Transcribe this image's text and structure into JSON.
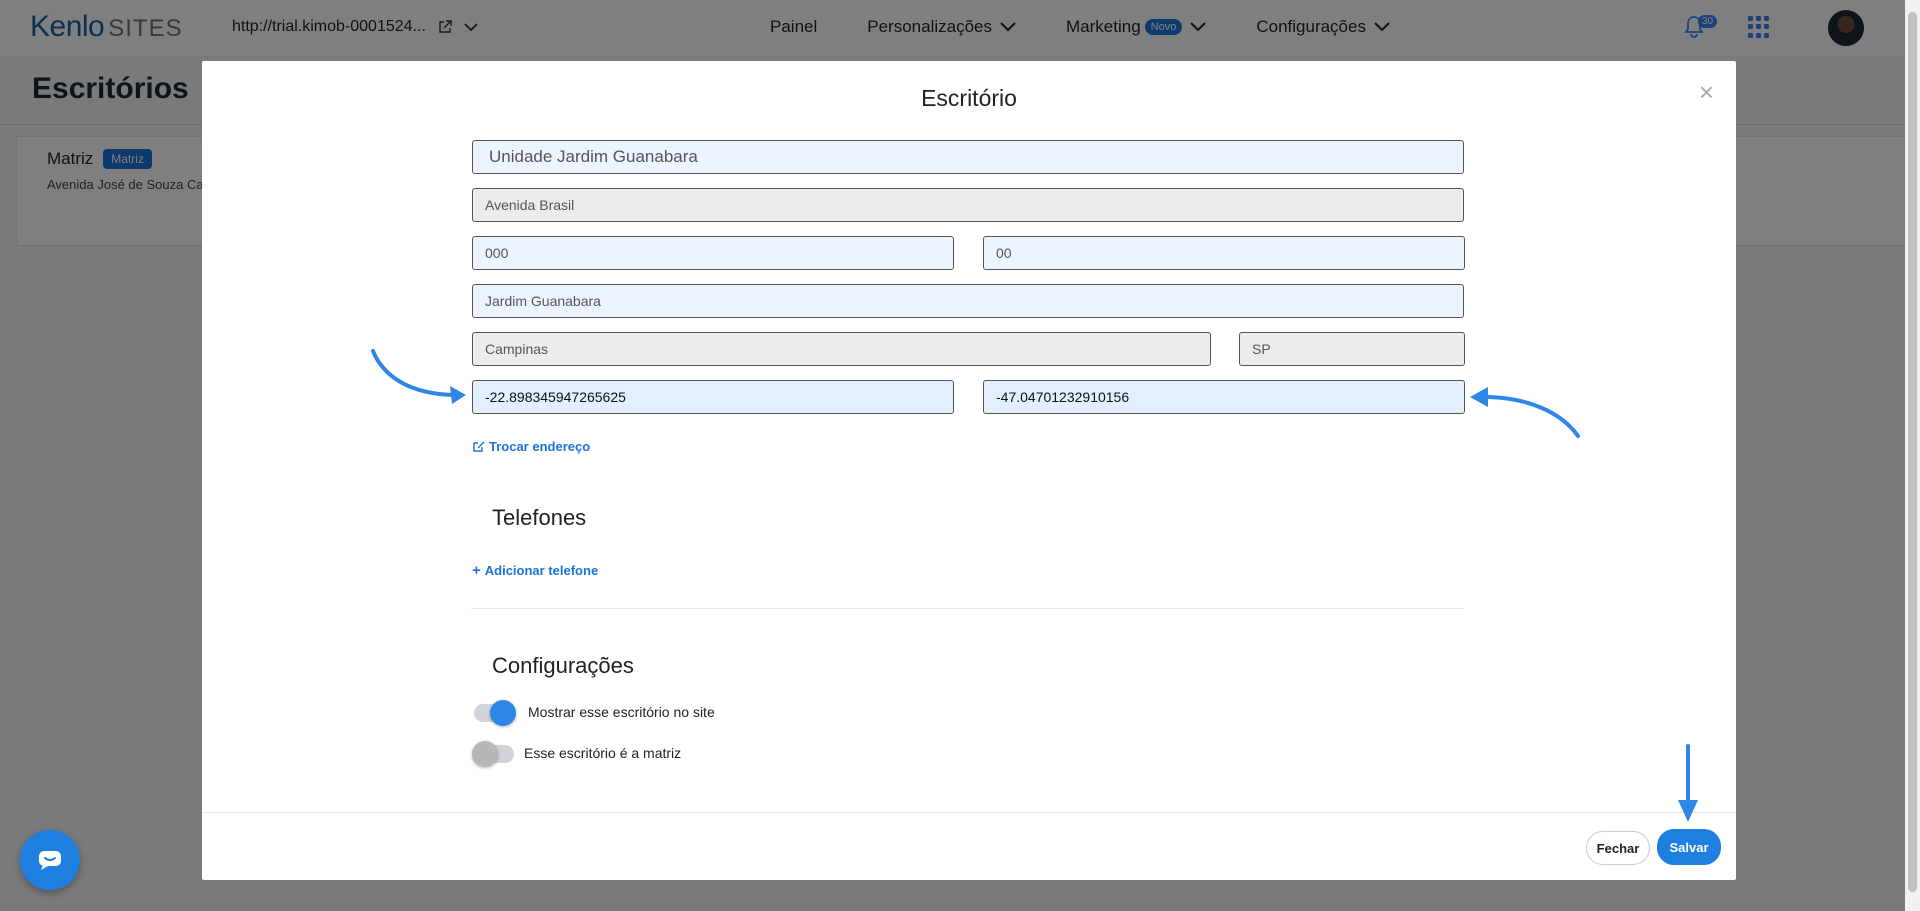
{
  "header": {
    "logo_brand": "Kenlo",
    "logo_sites": "SITES",
    "site_url": "http://trial.kimob-0001524...",
    "nav": [
      {
        "label": "Painel"
      },
      {
        "label": "Personalizações"
      },
      {
        "label": "Marketing"
      },
      {
        "label": "Configurações"
      }
    ],
    "marketing_badge": "Novo",
    "notifications_count": "30"
  },
  "page": {
    "title": "Escritórios",
    "card_title": "Matriz",
    "card_badge": "Matriz",
    "card_address": "Avenida José de Souza Ca"
  },
  "modal": {
    "title": "Escritório",
    "close_icon": "×",
    "fields": {
      "name": "Unidade Jardim Guanabara",
      "street": "Avenida Brasil",
      "number": "000",
      "complement": "00",
      "neighborhood": "Jardim Guanabara",
      "city": "Campinas",
      "state": "SP",
      "latitude": "-22.898345947265625",
      "longitude": "-47.04701232910156"
    },
    "change_address_link": "Trocar endereço",
    "phones_title": "Telefones",
    "add_phone_link": "Adicionar telefone",
    "settings_title": "Configurações",
    "toggle_show_label": "Mostrar esse escritório no site",
    "toggle_show_on": true,
    "toggle_main_label": "Esse escritório é a matriz",
    "toggle_main_on": false,
    "close_button": "Fechar",
    "save_button": "Salvar"
  },
  "colors": {
    "accent": "#1f7fe0",
    "annotation_arrow": "#2f86e6"
  }
}
